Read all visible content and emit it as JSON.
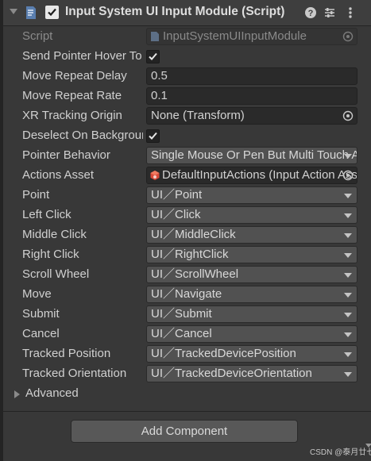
{
  "component": {
    "title": "Input System UI Input Module (Script)",
    "enabled": true
  },
  "fields": {
    "script": {
      "label": "Script",
      "value": "InputSystemUIInputModule"
    },
    "send_pointer_hover": {
      "label": "Send Pointer Hover To Parent",
      "checked": true
    },
    "move_repeat_delay": {
      "label": "Move Repeat Delay",
      "value": "0.5"
    },
    "move_repeat_rate": {
      "label": "Move Repeat Rate",
      "value": "0.1"
    },
    "xr_tracking_origin": {
      "label": "XR Tracking Origin",
      "value": "None (Transform)"
    },
    "deselect_on_background": {
      "label": "Deselect On Background Click",
      "checked": true
    },
    "pointer_behavior": {
      "label": "Pointer Behavior",
      "value": "Single Mouse Or Pen But Multi Touch And Track"
    },
    "actions_asset": {
      "label": "Actions Asset",
      "value": "DefaultInputActions (Input Action Asset)"
    },
    "point": {
      "label": "Point",
      "value": "UI／Point"
    },
    "left_click": {
      "label": "Left Click",
      "value": "UI／Click"
    },
    "middle_click": {
      "label": "Middle Click",
      "value": "UI／MiddleClick"
    },
    "right_click": {
      "label": "Right Click",
      "value": "UI／RightClick"
    },
    "scroll_wheel": {
      "label": "Scroll Wheel",
      "value": "UI／ScrollWheel"
    },
    "move": {
      "label": "Move",
      "value": "UI／Navigate"
    },
    "submit": {
      "label": "Submit",
      "value": "UI／Submit"
    },
    "cancel": {
      "label": "Cancel",
      "value": "UI／Cancel"
    },
    "tracked_position": {
      "label": "Tracked Position",
      "value": "UI／TrackedDevicePosition"
    },
    "tracked_orientation": {
      "label": "Tracked Orientation",
      "value": "UI／TrackedDeviceOrientation"
    }
  },
  "advanced": {
    "label": "Advanced"
  },
  "add_component": {
    "label": "Add Component"
  },
  "watermark": "CSDN @泰月廿七",
  "icons": {
    "foldout": "chevron-down-icon",
    "script": "script-component-icon",
    "help": "help-icon",
    "presets": "presets-icon",
    "menu": "kebab-menu-icon",
    "object_picker": "object-picker-icon",
    "input_asset": "input-action-asset-icon"
  },
  "colors": {
    "panel": "#383838",
    "header": "#3e3e3e",
    "field": "#2a2a2a",
    "dropdown": "#515151",
    "button": "#585858",
    "accent_blue": "#4a8fd6",
    "asset_red": "#d84a3a"
  }
}
